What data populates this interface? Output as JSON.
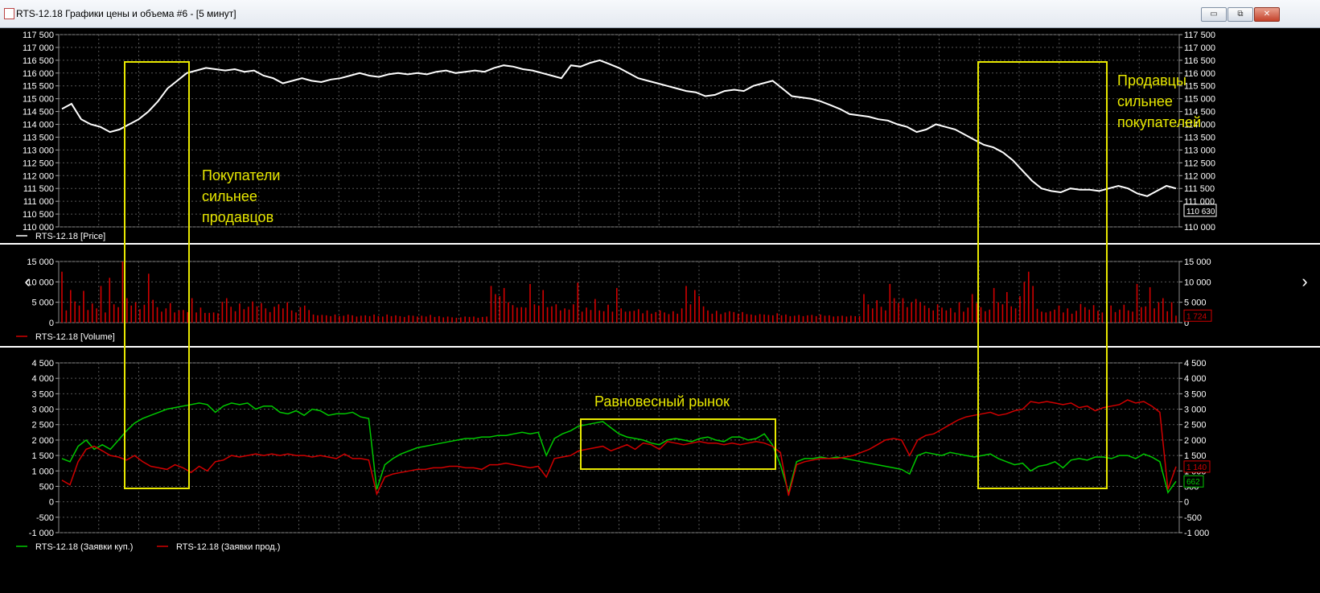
{
  "window": {
    "title": "RTS-12.18 Графики цены и объема #6 - [5 минут]",
    "icon": "chart-window-icon",
    "buttons": [
      {
        "name": "minimize-button",
        "glyph": "▭"
      },
      {
        "name": "restore-button",
        "glyph": "⧉"
      },
      {
        "name": "close-button",
        "glyph": "✕"
      }
    ]
  },
  "navigation": {
    "prev_glyph": "‹",
    "next_glyph": "›"
  },
  "colors": {
    "background": "#000000",
    "grid": "#555555",
    "axis_text": "#ffffff",
    "price_line": "#ffffff",
    "volume_bars": "#d00000",
    "bids_line": "#00c800",
    "asks_line": "#d00000",
    "annotation": "#e8e800",
    "separator": "#ffffff"
  },
  "chart_data": [
    {
      "type": "line",
      "panel": "price",
      "series": [
        {
          "name": "RTS-12.18 [Price]",
          "values": [
            114600,
            114800,
            114200,
            114000,
            113900,
            113700,
            113800,
            114000,
            114200,
            114500,
            114900,
            115400,
            115700,
            116000,
            116100,
            116200,
            116150,
            116100,
            116150,
            116050,
            116100,
            115900,
            115800,
            115600,
            115700,
            115800,
            115700,
            115650,
            115750,
            115800,
            115900,
            116000,
            115900,
            115850,
            115950,
            116000,
            115950,
            116000,
            115950,
            116050,
            116100,
            116000,
            116050,
            116100,
            116050,
            116200,
            116300,
            116250,
            116150,
            116100,
            116000,
            115900,
            115800,
            116300,
            116250,
            116400,
            116500,
            116350,
            116200,
            116000,
            115800,
            115700,
            115600,
            115500,
            115400,
            115300,
            115250,
            115100,
            115150,
            115300,
            115350,
            115300,
            115500,
            115600,
            115700,
            115400,
            115100,
            115050,
            115000,
            114900,
            114750,
            114600,
            114400,
            114350,
            114300,
            114200,
            114150,
            114000,
            113900,
            113700,
            113800,
            114000,
            113900,
            113800,
            113600,
            113400,
            113200,
            113100,
            112900,
            112600,
            112200,
            111800,
            111500,
            111400,
            111350,
            111500,
            111450,
            111450,
            111400,
            111500,
            111600,
            111500,
            111300,
            111200,
            111400,
            111600,
            111500
          ]
        }
      ],
      "ylim": [
        110000,
        117500
      ],
      "yticks": [
        "117 500",
        "117 000",
        "116 500",
        "116 000",
        "115 500",
        "115 000",
        "114 500",
        "114 000",
        "113 500",
        "113 000",
        "112 500",
        "112 000",
        "111 500",
        "111 000",
        "110 500",
        "110 000"
      ],
      "right_yticks": [
        "117 500",
        "117 000",
        "116 500",
        "116 000",
        "115 500",
        "115 000",
        "114 500",
        "114 000",
        "113 500",
        "113 000",
        "112 500",
        "112 000",
        "111 500",
        "111 000",
        "110 000"
      ],
      "last_value_label": "110 630",
      "grid": true,
      "legend": "bottom-left"
    },
    {
      "type": "bar",
      "panel": "volume",
      "series": [
        {
          "name": "RTS-12.18 [Volume]",
          "values": [
            12500,
            3000,
            8000,
            5200,
            4200,
            7800,
            3100,
            4700,
            3500,
            9000,
            2500,
            11000,
            4500,
            3800,
            15000,
            6000,
            4200,
            5000,
            3300,
            4400,
            12000,
            5600,
            3800,
            2700,
            3500,
            4800,
            2500,
            3000,
            3100,
            2600,
            6000,
            2500,
            3700,
            2400,
            2400,
            2500,
            2300,
            5100,
            6000,
            3900,
            2800,
            4700,
            3300,
            3900,
            5200,
            4000,
            4800,
            3500,
            2600,
            3900,
            4500,
            3500,
            5000,
            3000,
            2500,
            3800,
            4200,
            3100,
            2000,
            1800,
            1900,
            1800,
            1600,
            2000,
            1600,
            1700,
            2000,
            1800,
            1500,
            1700,
            1800,
            1600,
            2000,
            1600,
            1500,
            2000,
            1600,
            1800,
            1600,
            1400,
            1800,
            1700,
            1500,
            1700,
            1500,
            1900,
            1400,
            1600,
            1300,
            1500,
            1300,
            1200,
            1300,
            1500,
            1400,
            1500,
            1200,
            1400,
            1500,
            9000,
            7000,
            6500,
            8500,
            5000,
            4300,
            3700,
            3800,
            3700,
            9500,
            4500,
            4200,
            8000,
            3800,
            4000,
            4500,
            3000,
            3500,
            3200,
            4500,
            9800,
            2700,
            3700,
            3100,
            5800,
            3000,
            2800,
            4400,
            2700,
            8500,
            3500,
            2700,
            2800,
            2900,
            3300,
            2300,
            3000,
            2200,
            2600,
            3000,
            2500,
            2100,
            2800,
            2200,
            3500,
            9000,
            4500,
            8000,
            6500,
            4000,
            3000,
            2200,
            2900,
            2100,
            2500,
            2800,
            2600,
            2200,
            2600,
            2100,
            2000,
            1800,
            2100,
            2000,
            1900,
            1800,
            2300,
            1800,
            2000,
            1600,
            1700,
            1900,
            1600,
            1800,
            1900,
            1600,
            2000,
            1700,
            1800,
            1500,
            1600,
            1700,
            1500,
            1700,
            1600,
            1600,
            7000,
            4500,
            3500,
            5500,
            3900,
            3000,
            9500,
            6000,
            4800,
            6000,
            3800,
            5000,
            5800,
            5000,
            4200,
            3600,
            3000,
            4500,
            3700,
            3000,
            3600,
            2500,
            5000,
            2700,
            3700,
            7000,
            4800,
            3800,
            2800,
            3200,
            8500,
            5000,
            4500,
            7500,
            4000,
            3500,
            6500,
            10000,
            12500,
            9000,
            3400,
            2700,
            2500,
            2800,
            3200,
            4200,
            2500,
            3500,
            2200,
            2900,
            4600,
            3800,
            3200,
            4300,
            2900,
            2500,
            3500,
            4200,
            2600,
            3200,
            4400,
            3000,
            2700,
            9500,
            3800,
            4000,
            8700,
            3500,
            5000,
            6000,
            2800,
            5000,
            1724
          ],
          "outliers": [
            12000,
            15000
          ]
        }
      ],
      "ylim": [
        0,
        15000
      ],
      "yticks": [
        "15 000",
        "10 000",
        "5 000",
        "0"
      ],
      "last_value_label": "1 724",
      "grid": true,
      "legend": "bottom-left"
    },
    {
      "type": "line",
      "panel": "orders",
      "series": [
        {
          "name": "RTS-12.18 (Заявки куп.)",
          "color": "#00c800",
          "values": [
            1400,
            1300,
            1800,
            2000,
            1700,
            1850,
            1700,
            2000,
            2300,
            2550,
            2700,
            2800,
            2900,
            3000,
            3050,
            3100,
            3150,
            3200,
            3150,
            2900,
            3100,
            3200,
            3150,
            3200,
            3000,
            3100,
            3100,
            2900,
            2850,
            2950,
            2800,
            3000,
            2950,
            2800,
            2850,
            2850,
            2900,
            2750,
            2700,
            400,
            1200,
            1400,
            1550,
            1650,
            1750,
            1800,
            1850,
            1900,
            1950,
            2000,
            2050,
            2050,
            2100,
            2100,
            2150,
            2150,
            2200,
            2250,
            2200,
            2250,
            1500,
            2050,
            2200,
            2300,
            2450,
            2500,
            2550,
            2600,
            2400,
            2200,
            2100,
            2050,
            2000,
            1900,
            1850,
            2000,
            2050,
            2000,
            1950,
            2050,
            2100,
            2000,
            1950,
            2100,
            2100,
            2000,
            2050,
            2200,
            1850,
            1200,
            300,
            1300,
            1400,
            1400,
            1450,
            1400,
            1450,
            1400,
            1350,
            1300,
            1250,
            1200,
            1150,
            1100,
            1050,
            900,
            1500,
            1600,
            1550,
            1500,
            1600,
            1550,
            1500,
            1450,
            1500,
            1550,
            1400,
            1300,
            1200,
            1250,
            1000,
            1150,
            1200,
            1300,
            1100,
            1350,
            1400,
            1350,
            1450,
            1450,
            1400,
            1500,
            1500,
            1400,
            1550,
            1450,
            1300,
            300,
            662
          ]
        },
        {
          "name": "RTS-12.18 (Заявки прод.)",
          "color": "#d00000",
          "values": [
            700,
            550,
            1300,
            1700,
            1800,
            1650,
            1500,
            1450,
            1350,
            1500,
            1300,
            1150,
            1100,
            1050,
            1200,
            1100,
            950,
            1150,
            1000,
            1300,
            1350,
            1500,
            1450,
            1500,
            1550,
            1500,
            1550,
            1500,
            1550,
            1500,
            1500,
            1450,
            1500,
            1450,
            1400,
            1550,
            1400,
            1400,
            1350,
            250,
            800,
            900,
            950,
            1000,
            1050,
            1050,
            1100,
            1100,
            1150,
            1150,
            1100,
            1100,
            1050,
            1200,
            1200,
            1250,
            1200,
            1150,
            1100,
            1150,
            800,
            1400,
            1450,
            1500,
            1650,
            1700,
            1750,
            1800,
            1650,
            1750,
            1850,
            1700,
            1900,
            1850,
            1700,
            1950,
            1900,
            1850,
            1900,
            1950,
            1900,
            1900,
            1850,
            1900,
            1850,
            1900,
            1950,
            1900,
            1800,
            1600,
            200,
            1200,
            1300,
            1350,
            1400,
            1400,
            1400,
            1450,
            1500,
            1600,
            1700,
            1850,
            2000,
            2050,
            2000,
            1500,
            2000,
            2150,
            2200,
            2350,
            2500,
            2650,
            2750,
            2800,
            2850,
            2900,
            2800,
            2850,
            2950,
            3000,
            3250,
            3200,
            3250,
            3200,
            3150,
            3200,
            3050,
            3100,
            2950,
            3050,
            3100,
            3150,
            3300,
            3200,
            3250,
            3100,
            2900,
            400,
            1140
          ]
        }
      ],
      "ylim": [
        -1000,
        4500
      ],
      "yticks": [
        "4 500",
        "4 000",
        "3 500",
        "3 000",
        "2 500",
        "2 000",
        "1 500",
        "1 000",
        "500",
        "0",
        "-500",
        "-1 000"
      ],
      "last_value_labels": {
        "bids": "662",
        "asks": "1 140"
      },
      "grid": true,
      "legend": "bottom-left"
    }
  ],
  "annotations": {
    "buyers_text": [
      "Покупатели",
      "сильнее",
      "продавцов"
    ],
    "sellers_text": [
      "Продавцы",
      "сильнее",
      "покупателей"
    ],
    "equilibrium_text": "Равновесный рынок"
  }
}
